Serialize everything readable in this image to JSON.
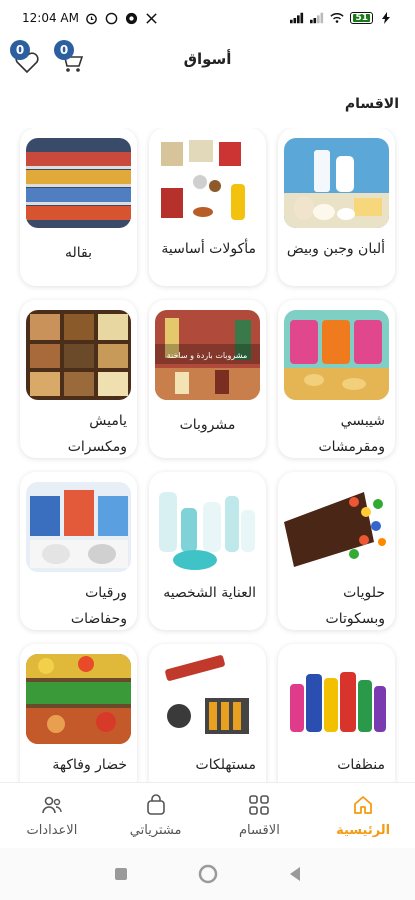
{
  "status_bar": {
    "time": "12:04 AM",
    "battery": "51"
  },
  "header": {
    "title": "أسواق",
    "favorites_count": "0",
    "cart_count": "0"
  },
  "section_title": "الاقسام",
  "categories": [
    {
      "label": "ألبان وجبن وبيض"
    },
    {
      "label": "مأكولات أساسية"
    },
    {
      "label": "بقاله"
    },
    {
      "label": "شيبسي ومقرمشات"
    },
    {
      "label": "مشروبات",
      "image_text": "مشروبات باردة و ساخنة"
    },
    {
      "label": "ياميش ومكسرات"
    },
    {
      "label": "حلويات وبسكوتات"
    },
    {
      "label": "العناية الشخصيه"
    },
    {
      "label": "ورقيات وحفاضات"
    },
    {
      "label": "منظفات ومطهرات"
    },
    {
      "label": "مستهلكات وبطاريات"
    },
    {
      "label": "خضار وفاكهة"
    }
  ],
  "bottom_nav": [
    {
      "label": "الرئيسية",
      "icon": "home-icon",
      "active": true
    },
    {
      "label": "الاقسام",
      "icon": "grid-icon",
      "active": false
    },
    {
      "label": "مشترياتي",
      "icon": "bag-icon",
      "active": false
    },
    {
      "label": "الاعدادات",
      "icon": "users-icon",
      "active": false
    }
  ],
  "colors": {
    "accent": "#f39c12",
    "badge": "#2b5fa0"
  }
}
